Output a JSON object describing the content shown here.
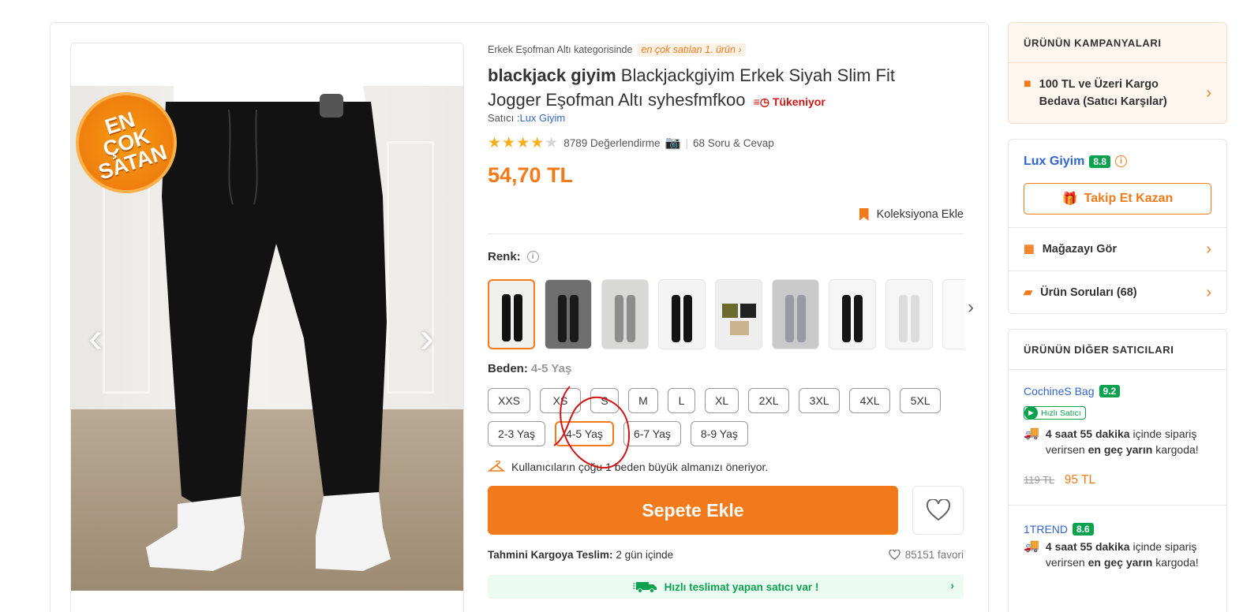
{
  "breadcrumb": {
    "category_text": "Erkek Eşofman Altı kategorisinde",
    "bestseller_tag": "en çok satılan 1. ürün"
  },
  "product": {
    "brand": "blackjack giyim",
    "name": "Blackjackgiyim Erkek Siyah Slim Fit",
    "name_line2": "Jogger Eşofman Altı syhesfmfkoo",
    "stock_badge": "Tükeniyor",
    "seller_prefix": "Satıcı :",
    "seller_name": "Lux Giyim",
    "rating_count": "8789 Değerlendirme",
    "qa_count": "68 Soru & Cevap",
    "price": "54,70 TL",
    "collection_label": "Koleksiyona Ekle",
    "image_badge": "EN ÇOK SATAN"
  },
  "color": {
    "label": "Renk:"
  },
  "size": {
    "label": "Beden:",
    "selected_value": "4-5 Yaş",
    "row1": [
      "XXS",
      "XS",
      "S",
      "M",
      "L",
      "XL",
      "2XL",
      "3XL",
      "4XL",
      "5XL"
    ],
    "row2": [
      "2-3 Yaş",
      "4-5 Yaş",
      "6-7 Yaş",
      "8-9 Yaş"
    ]
  },
  "recommendation": "Kullanıcıların çoğu 1 beden büyük almanızı öneriyor.",
  "cart": {
    "add_label": "Sepete Ekle"
  },
  "delivery": {
    "label": "Tahmini Kargoya Teslim:",
    "value": "2 gün içinde",
    "favorites": "85151 favori",
    "fast_seller_banner": "Hızlı teslimat yapan satıcı var !"
  },
  "campaigns": {
    "title": "ÜRÜNÜN KAMPANYALARI",
    "item": "100 TL ve Üzeri Kargo Bedava (Satıcı Karşılar)"
  },
  "store": {
    "name": "Lux Giyim",
    "score": "8.8",
    "follow_label": "Takip Et Kazan",
    "view_store": "Mağazayı Gör",
    "questions": "Ürün Soruları (68)"
  },
  "other_sellers": {
    "title": "ÜRÜNÜN DİĞER SATICILARI",
    "sellers": [
      {
        "name": "CochineS Bag",
        "score": "9.2",
        "fast_badge": "Hızlı Satıcı",
        "ship_time": "4 saat 55 dakika",
        "ship_mid": " içinde sipariş verirsen ",
        "ship_when": "en geç yarın",
        "ship_end": " kargoda!",
        "old_price": "119 TL",
        "new_price": "95 TL"
      },
      {
        "name": "1TREND",
        "score": "8.6",
        "ship_time": "4 saat 55 dakika",
        "ship_mid": " içinde sipariş verirsen ",
        "ship_when": "en geç yarın",
        "ship_end": " kargoda!"
      }
    ]
  },
  "colors": {
    "accent": "#f27a1a",
    "link": "#3366cc",
    "success": "#0aa14f",
    "danger": "#d21313"
  }
}
